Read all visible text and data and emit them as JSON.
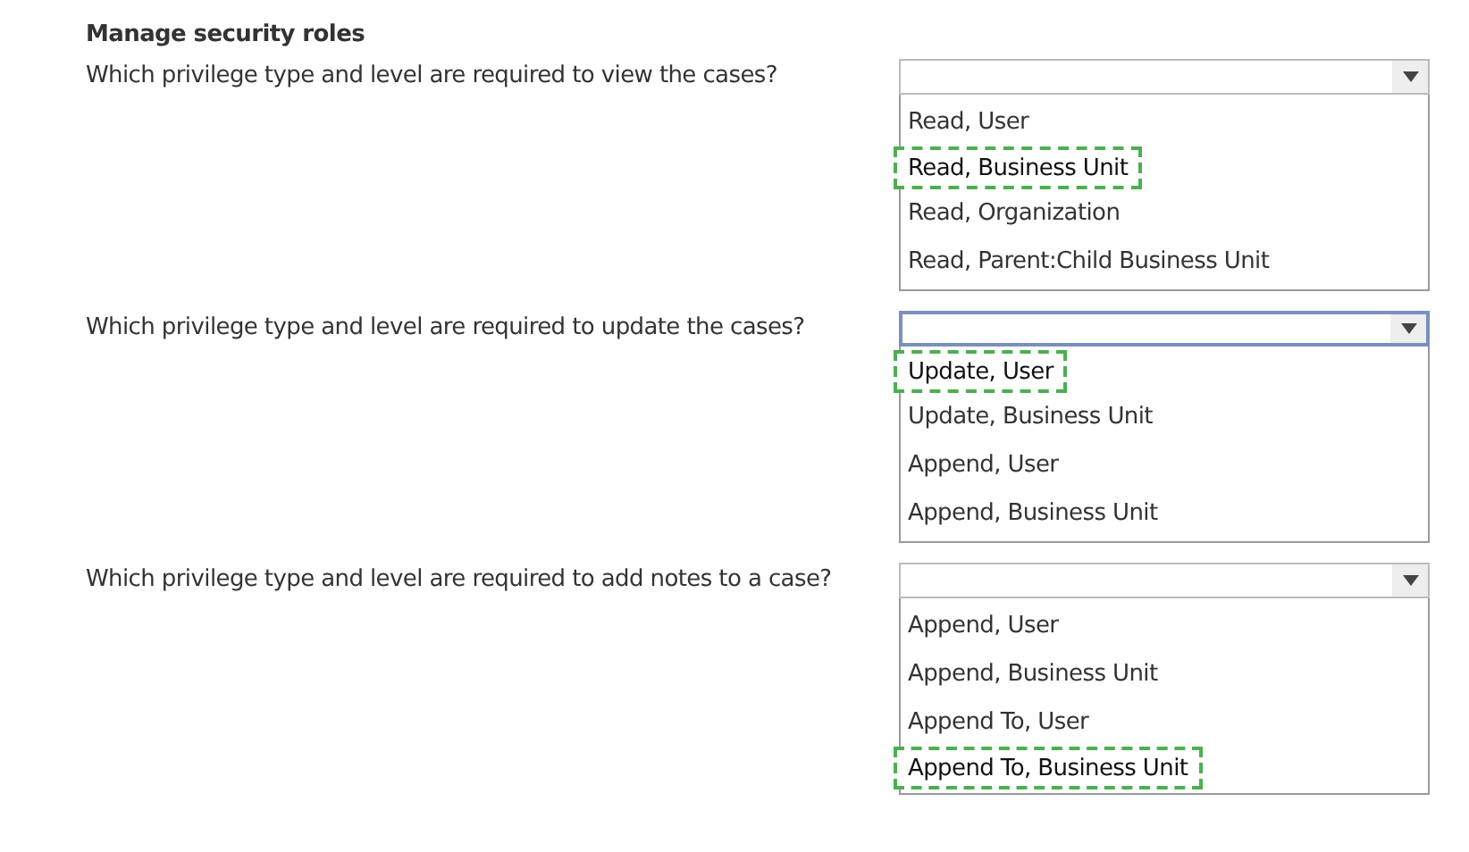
{
  "heading": "Manage security roles",
  "questions": [
    {
      "prompt": "Which privilege type and level are required to view the cases?",
      "focused": false,
      "options": [
        {
          "label": "Read, User",
          "selected": false
        },
        {
          "label": "Read, Business Unit",
          "selected": true
        },
        {
          "label": "Read, Organization",
          "selected": false
        },
        {
          "label": "Read, Parent:Child Business Unit",
          "selected": false
        }
      ]
    },
    {
      "prompt": "Which privilege type and level are required to update the cases?",
      "focused": true,
      "options": [
        {
          "label": "Update, User",
          "selected": true
        },
        {
          "label": "Update, Business Unit",
          "selected": false
        },
        {
          "label": "Append, User",
          "selected": false
        },
        {
          "label": "Append, Business Unit",
          "selected": false
        }
      ]
    },
    {
      "prompt": "Which privilege type and level are required to add notes to a case?",
      "focused": false,
      "options": [
        {
          "label": "Append, User",
          "selected": false
        },
        {
          "label": "Append, Business Unit",
          "selected": false
        },
        {
          "label": "Append To, User",
          "selected": false
        },
        {
          "label": "Append To, Business Unit",
          "selected": true
        }
      ]
    }
  ]
}
